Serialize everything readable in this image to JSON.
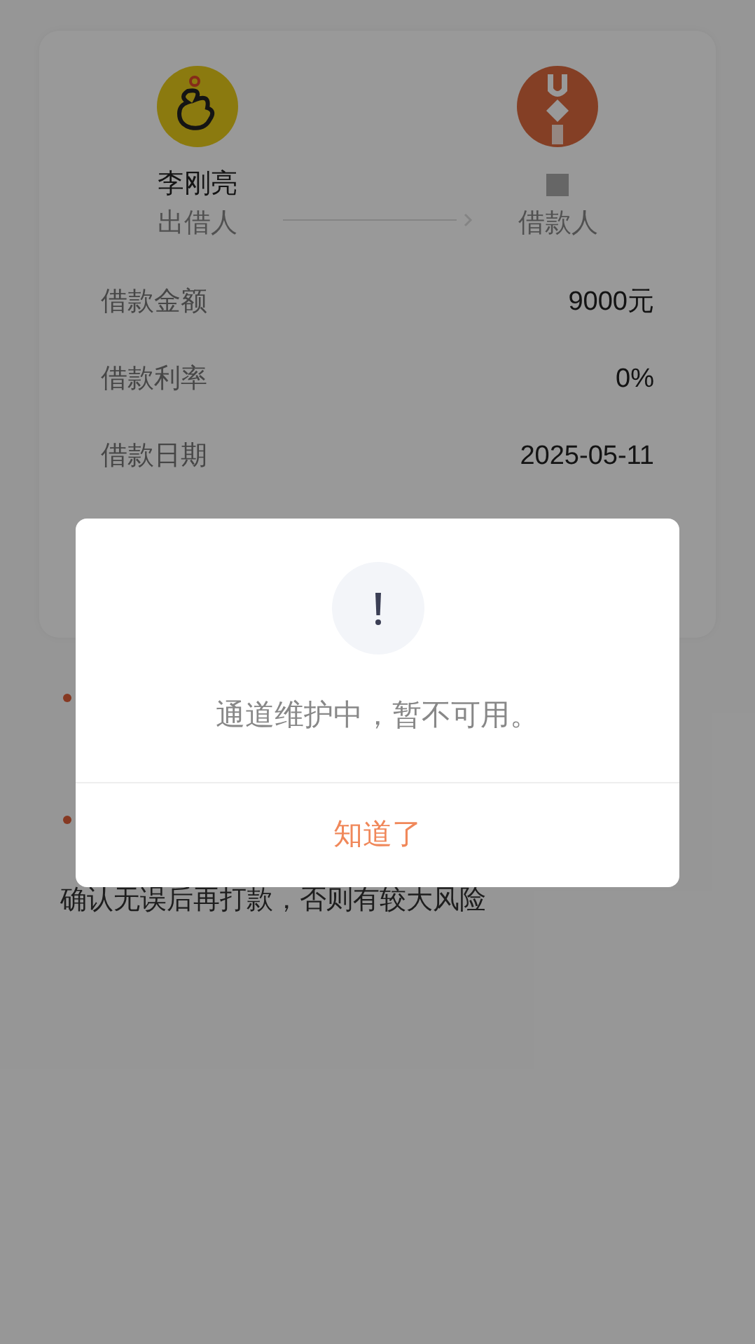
{
  "loan_card": {
    "lender": {
      "name": "李刚亮",
      "role": "出借人"
    },
    "borrower": {
      "role": "借款人"
    },
    "rows": [
      {
        "label": "借款金额",
        "value": "9000元"
      },
      {
        "label": "借款利率",
        "value": "0%"
      },
      {
        "label": "借款日期",
        "value": "2025-05-11"
      }
    ]
  },
  "notes": {
    "last_line": "确认无误后再打款，否则有较大风险"
  },
  "dialog": {
    "message": "通道维护中，暂不可用。",
    "button": "知道了"
  }
}
